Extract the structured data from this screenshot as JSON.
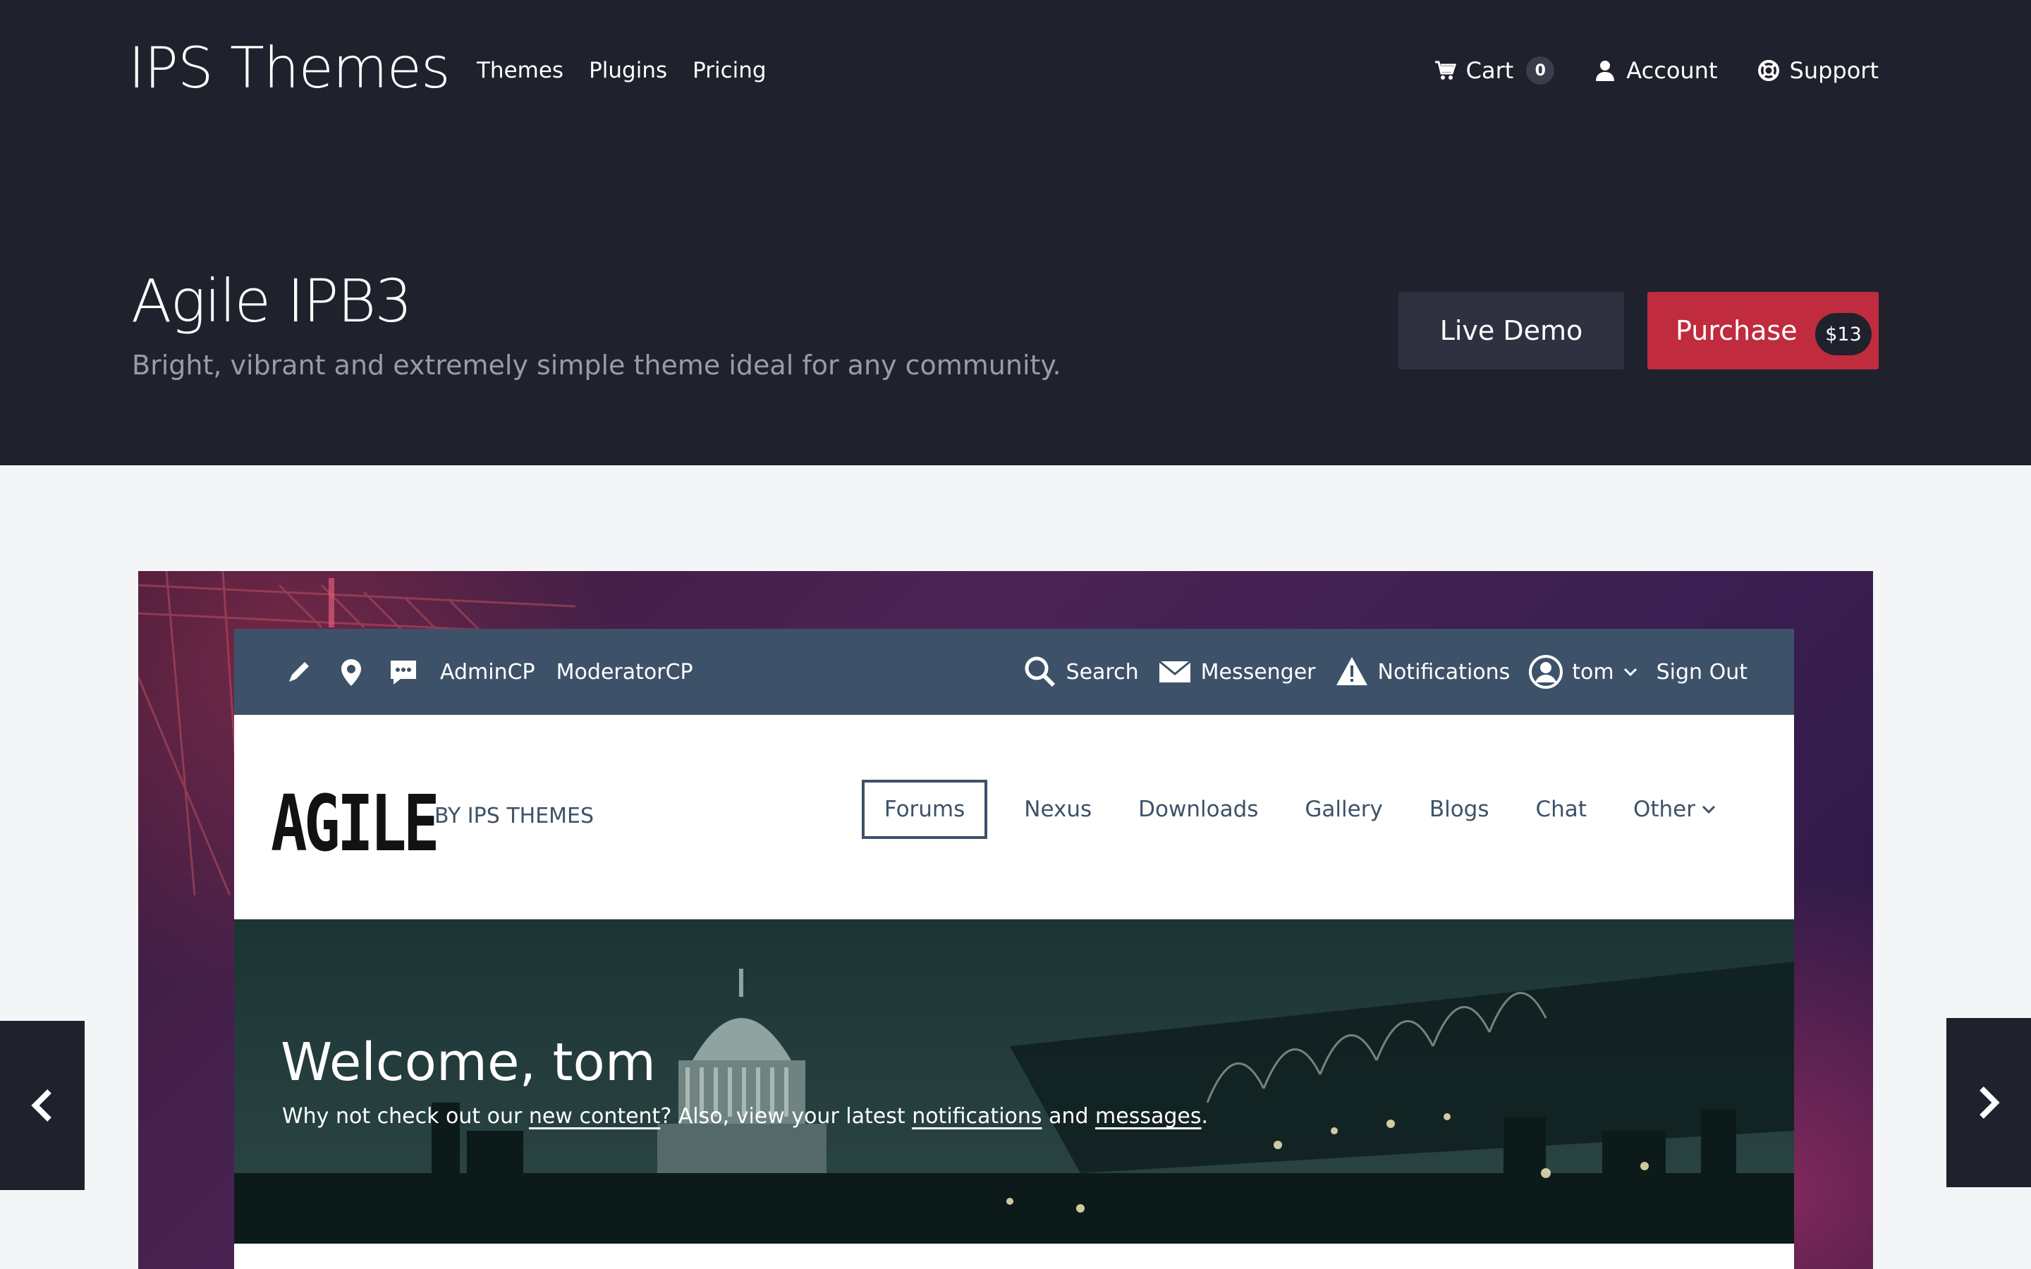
{
  "brand": "IPS Themes",
  "main_nav": [
    "Themes",
    "Plugins",
    "Pricing"
  ],
  "user_nav": {
    "cart_label": "Cart",
    "cart_count": "0",
    "account_label": "Account",
    "support_label": "Support"
  },
  "product": {
    "title": "Agile IPB3",
    "subtitle": "Bright, vibrant and extremely simple theme ideal for any community.",
    "demo_label": "Live Demo",
    "purchase_label": "Purchase",
    "price": "$13"
  },
  "preview": {
    "userbar": {
      "links": [
        "AdminCP",
        "ModeratorCP"
      ],
      "search": "Search",
      "messenger": "Messenger",
      "notifications": "Notifications",
      "user": "tom",
      "signout": "Sign Out"
    },
    "logo": "AGILE",
    "byline": "BY IPS THEMES",
    "nav": [
      "Forums",
      "Nexus",
      "Downloads",
      "Gallery",
      "Blogs",
      "Chat",
      "Other"
    ],
    "active_nav": "Forums",
    "welcome_title": "Welcome, tom",
    "welcome_text": {
      "part1": "Why not check out our ",
      "link1": "new content",
      "part2": "? Also, view your latest ",
      "link2": "notifications",
      "part3": " and ",
      "link3": "messages",
      "part4": "."
    }
  },
  "colors": {
    "header_bg": "#1f212c",
    "purchase": "#c02b3e",
    "preview_bar": "#3d5269"
  }
}
